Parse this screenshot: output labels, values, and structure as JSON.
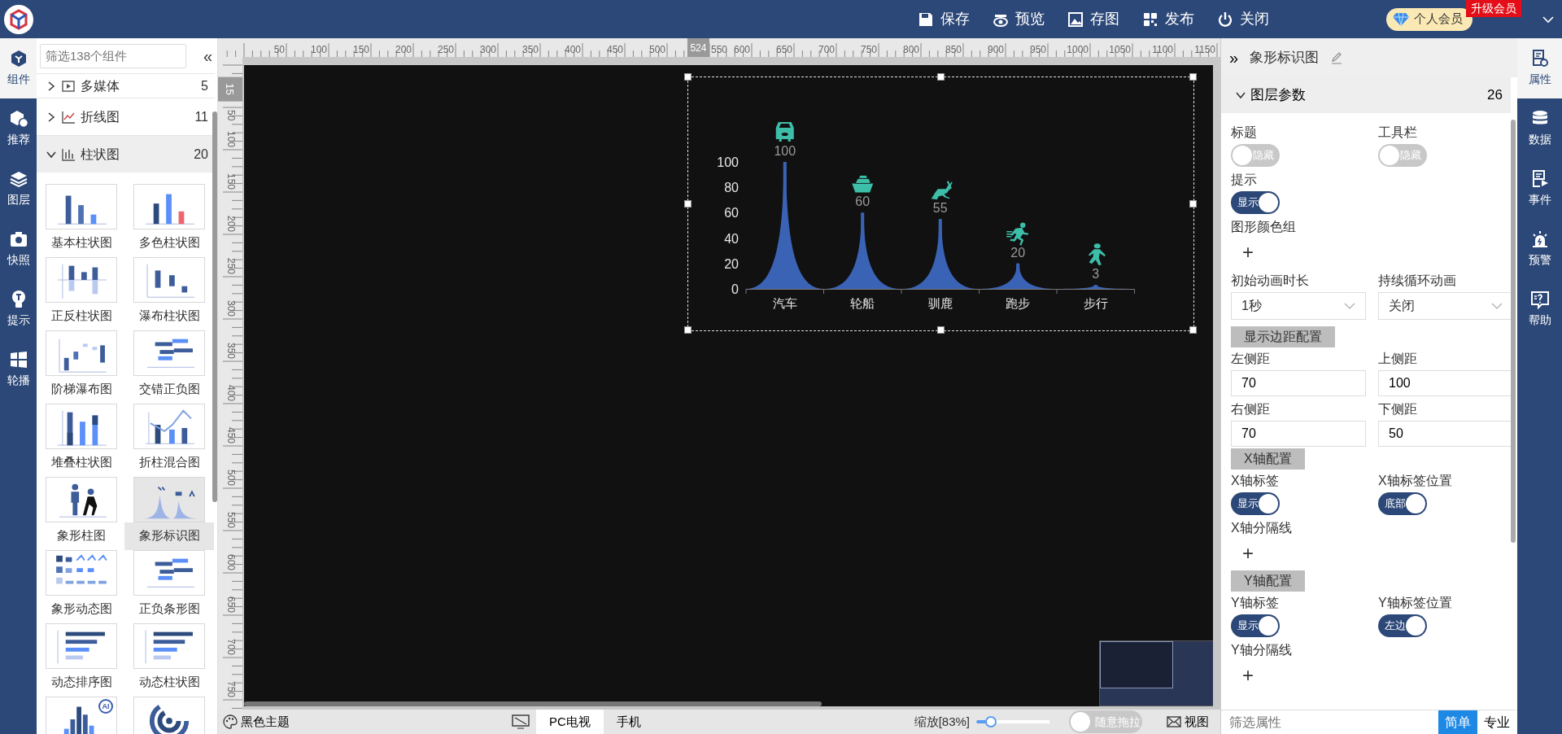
{
  "topbar": {
    "actions": [
      "保存",
      "预览",
      "存图",
      "发布",
      "关闭"
    ],
    "member": "个人会员",
    "upgrade": "升级会员"
  },
  "left_nav": [
    {
      "label": "组件",
      "selected": true
    },
    {
      "label": "推荐",
      "selected": false
    },
    {
      "label": "图层",
      "selected": false
    },
    {
      "label": "快照",
      "selected": false
    },
    {
      "label": "提示",
      "selected": false
    },
    {
      "label": "轮播",
      "selected": false
    }
  ],
  "component_panel": {
    "search": {
      "placeholder": "筛选138个组件"
    },
    "collapse": "«",
    "groups": [
      {
        "label": "多媒体",
        "count": "5",
        "expanded": false
      },
      {
        "label": "折线图",
        "count": "11",
        "expanded": false
      },
      {
        "label": "柱状图",
        "count": "20",
        "expanded": true
      }
    ],
    "items": [
      {
        "label": "基本柱状图",
        "kind": "bars",
        "selected": false
      },
      {
        "label": "多色柱状图",
        "kind": "multicolor",
        "selected": false
      },
      {
        "label": "正反柱状图",
        "kind": "diverging",
        "selected": false
      },
      {
        "label": "瀑布柱状图",
        "kind": "waterfall",
        "selected": false
      },
      {
        "label": "阶梯瀑布图",
        "kind": "steps",
        "selected": false
      },
      {
        "label": "交错正负图",
        "kind": "hbars",
        "selected": false
      },
      {
        "label": "堆叠柱状图",
        "kind": "stacked",
        "selected": false
      },
      {
        "label": "折柱混合图",
        "kind": "linebars",
        "selected": false
      },
      {
        "label": "象形柱图",
        "kind": "people",
        "selected": false
      },
      {
        "label": "象形标识图",
        "kind": "peaks",
        "selected": true
      },
      {
        "label": "象形动态图",
        "kind": "pictogrid",
        "selected": false
      },
      {
        "label": "正负条形图",
        "kind": "hbars",
        "selected": false
      },
      {
        "label": "动态排序图",
        "kind": "sorted",
        "selected": false
      },
      {
        "label": "动态柱状图",
        "kind": "sorted",
        "selected": false
      },
      {
        "kind": "histogram",
        "badge": "AI",
        "selected": false
      },
      {
        "kind": "radial",
        "selected": false
      }
    ]
  },
  "ruler": {
    "top_labels": [
      "50",
      "100",
      "150",
      "200",
      "250",
      "300",
      "350",
      "400",
      "450",
      "500",
      "550",
      "600",
      "650",
      "700",
      "750",
      "800",
      "850",
      "900",
      "950",
      "1000",
      "1050",
      "1100",
      "1150"
    ],
    "top_marker": "524",
    "left_labels": [
      "50",
      "100",
      "150",
      "200",
      "250",
      "300",
      "350",
      "400",
      "450",
      "500",
      "550",
      "600",
      "650",
      "700",
      "750"
    ],
    "left_marker": "15"
  },
  "chart": {
    "chart_data": {
      "type": "bar",
      "categories": [
        "汽车",
        "轮船",
        "驯鹿",
        "跑步",
        "步行"
      ],
      "values": [
        100,
        60,
        55,
        20,
        3
      ],
      "ylim": [
        0,
        100
      ],
      "yticks": [
        0,
        20,
        40,
        60,
        80,
        100
      ],
      "data_labels": true
    }
  },
  "bottom_bar": {
    "theme": "黑色主题",
    "devices": [
      {
        "label": "PC电视",
        "selected": true
      },
      {
        "label": "手机",
        "selected": false
      }
    ],
    "zoom_label": "缩放[83%]",
    "zoom": {
      "level": 0.2
    },
    "drag": {
      "label": "随意拖拉",
      "on": false
    },
    "view": "视图"
  },
  "properties": {
    "expand": "»",
    "title": "象形标识图",
    "section": {
      "label": "图层参数",
      "count": "26",
      "expanded": true
    },
    "rows": [
      [
        {
          "label": "标题",
          "kind": "toggle",
          "on": false,
          "text": "隐藏"
        },
        {
          "label": "工具栏",
          "kind": "toggle",
          "on": false,
          "text": "隐藏"
        }
      ],
      [
        {
          "label": "提示",
          "kind": "toggle",
          "on": true,
          "text": "显示"
        }
      ],
      [
        {
          "label": "图形颜色组",
          "kind": "add",
          "text": "+"
        }
      ],
      [
        {
          "label": "初始动画时长",
          "kind": "select",
          "value": "1秒"
        },
        {
          "label": "持续循环动画",
          "kind": "select",
          "value": "关闭"
        }
      ],
      [
        {
          "kind": "group",
          "text": "显示边距配置"
        }
      ],
      [
        {
          "label": "左侧距",
          "kind": "input",
          "value": "70"
        },
        {
          "label": "上侧距",
          "kind": "input",
          "value": "100"
        }
      ],
      [
        {
          "label": "右侧距",
          "kind": "input",
          "value": "70"
        },
        {
          "label": "下侧距",
          "kind": "input",
          "value": "50"
        }
      ],
      [
        {
          "kind": "group",
          "text": "X轴配置"
        }
      ],
      [
        {
          "label": "X轴标签",
          "kind": "toggle",
          "on": true,
          "text": "显示"
        },
        {
          "label": "X轴标签位置",
          "kind": "toggle",
          "on": true,
          "text": "底部"
        }
      ],
      [
        {
          "label": "X轴分隔线",
          "kind": "add",
          "text": "+"
        }
      ],
      [
        {
          "kind": "group",
          "text": "Y轴配置"
        }
      ],
      [
        {
          "label": "Y轴标签",
          "kind": "toggle",
          "on": true,
          "text": "显示"
        },
        {
          "label": "Y轴标签位置",
          "kind": "toggle",
          "on": true,
          "text": "左边"
        }
      ],
      [
        {
          "label": "Y轴分隔线",
          "kind": "add",
          "text": "+"
        }
      ]
    ],
    "filter": {
      "placeholder": "筛选属性"
    },
    "modes": [
      {
        "label": "简单",
        "selected": true
      },
      {
        "label": "专业",
        "selected": false
      }
    ]
  },
  "right_nav": [
    {
      "label": "属性",
      "selected": true
    },
    {
      "label": "数据",
      "selected": false
    },
    {
      "label": "事件",
      "selected": false
    },
    {
      "label": "预警",
      "selected": false
    },
    {
      "label": "帮助",
      "selected": false
    }
  ]
}
